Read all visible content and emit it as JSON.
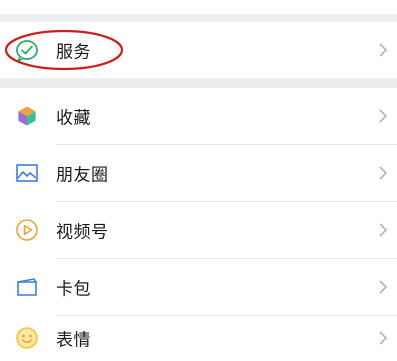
{
  "menu": {
    "service": {
      "label": "服务",
      "icon": "service-check-icon"
    },
    "favorites": {
      "label": "收藏",
      "icon": "cube-icon"
    },
    "moments": {
      "label": "朋友圈",
      "icon": "image-icon"
    },
    "channels": {
      "label": "视频号",
      "icon": "play-circle-icon"
    },
    "cards": {
      "label": "卡包",
      "icon": "wallet-card-icon"
    },
    "stickers": {
      "label": "表情",
      "icon": "smiley-icon"
    }
  },
  "colors": {
    "section_gap": "#ededed",
    "text": "#1a1a1a",
    "chevron": "#b2b2b2",
    "annotation": "#cc1f1f",
    "service_green": "#2aae67",
    "favorites_orange": "#f3a33a",
    "moments_blue": "#3f7fd4",
    "channels_orange": "#f0a040",
    "cards_blue": "#3b86d6",
    "stickers_yellow": "#f5c542"
  }
}
